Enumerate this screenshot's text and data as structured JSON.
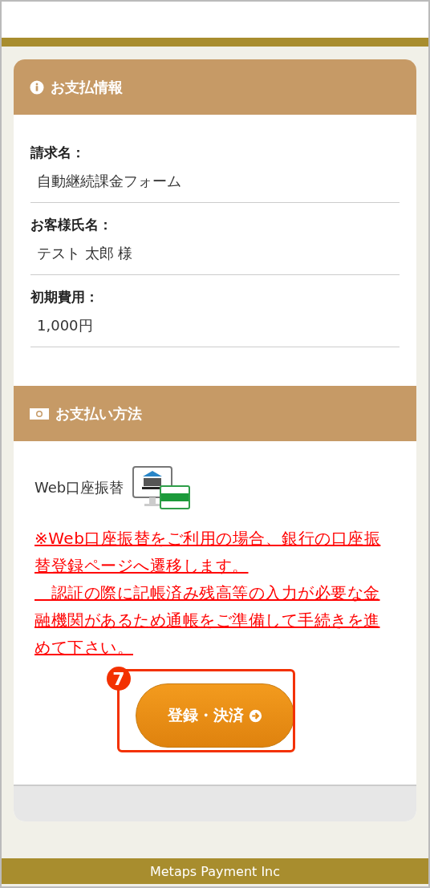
{
  "sections": [
    {
      "kind": "info",
      "title": "お支払情報",
      "fields": [
        {
          "label": "請求名：",
          "value": "自動継続課金フォーム"
        },
        {
          "label": "お客様氏名：",
          "value": "テスト 太郎 様"
        },
        {
          "label": "初期費用：",
          "value": "1,000円"
        }
      ]
    },
    {
      "kind": "method",
      "title": "お支払い方法",
      "method": "Web口座振替",
      "notes": [
        "※Web口座振替をご利用の場合、銀行の口座振替登録ページへ遷移します。",
        "　認証の際に記帳済み残高等の入力が必要な金融機関があるため通帳をご準備して手続きを進めて下さい。"
      ],
      "button": "登録・決済",
      "annotation": "7"
    }
  ],
  "footer": "Metaps Payment Inc"
}
